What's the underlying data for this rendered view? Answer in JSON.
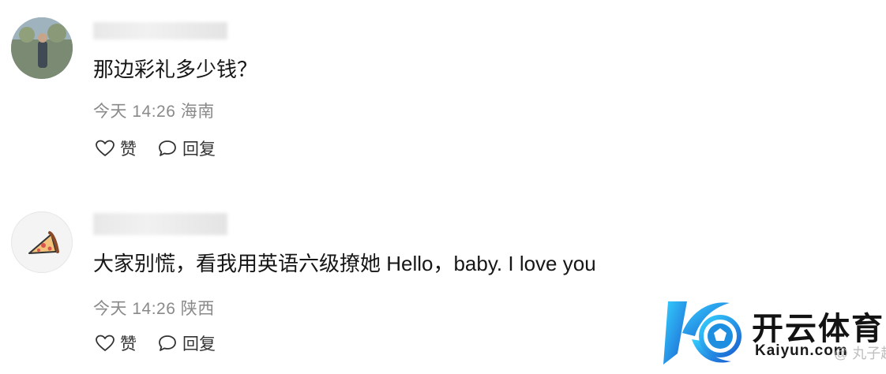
{
  "comments": [
    {
      "username": "",
      "text": "那边彩礼多少钱？",
      "meta": "今天 14:26 海南",
      "like_label": "赞",
      "reply_label": "回复"
    },
    {
      "username": "",
      "text": "大家别慌，看我用英语六级撩她 Hello，baby. I love you",
      "meta": "今天 14:26 陕西",
      "like_label": "赞",
      "reply_label": "回复"
    }
  ],
  "watermark": {
    "brand_cn": "开云体育",
    "brand_en": "Kaiyun.com",
    "overlay_text": "@ 丸子趣谈",
    "accent": "#1e8fe0"
  }
}
